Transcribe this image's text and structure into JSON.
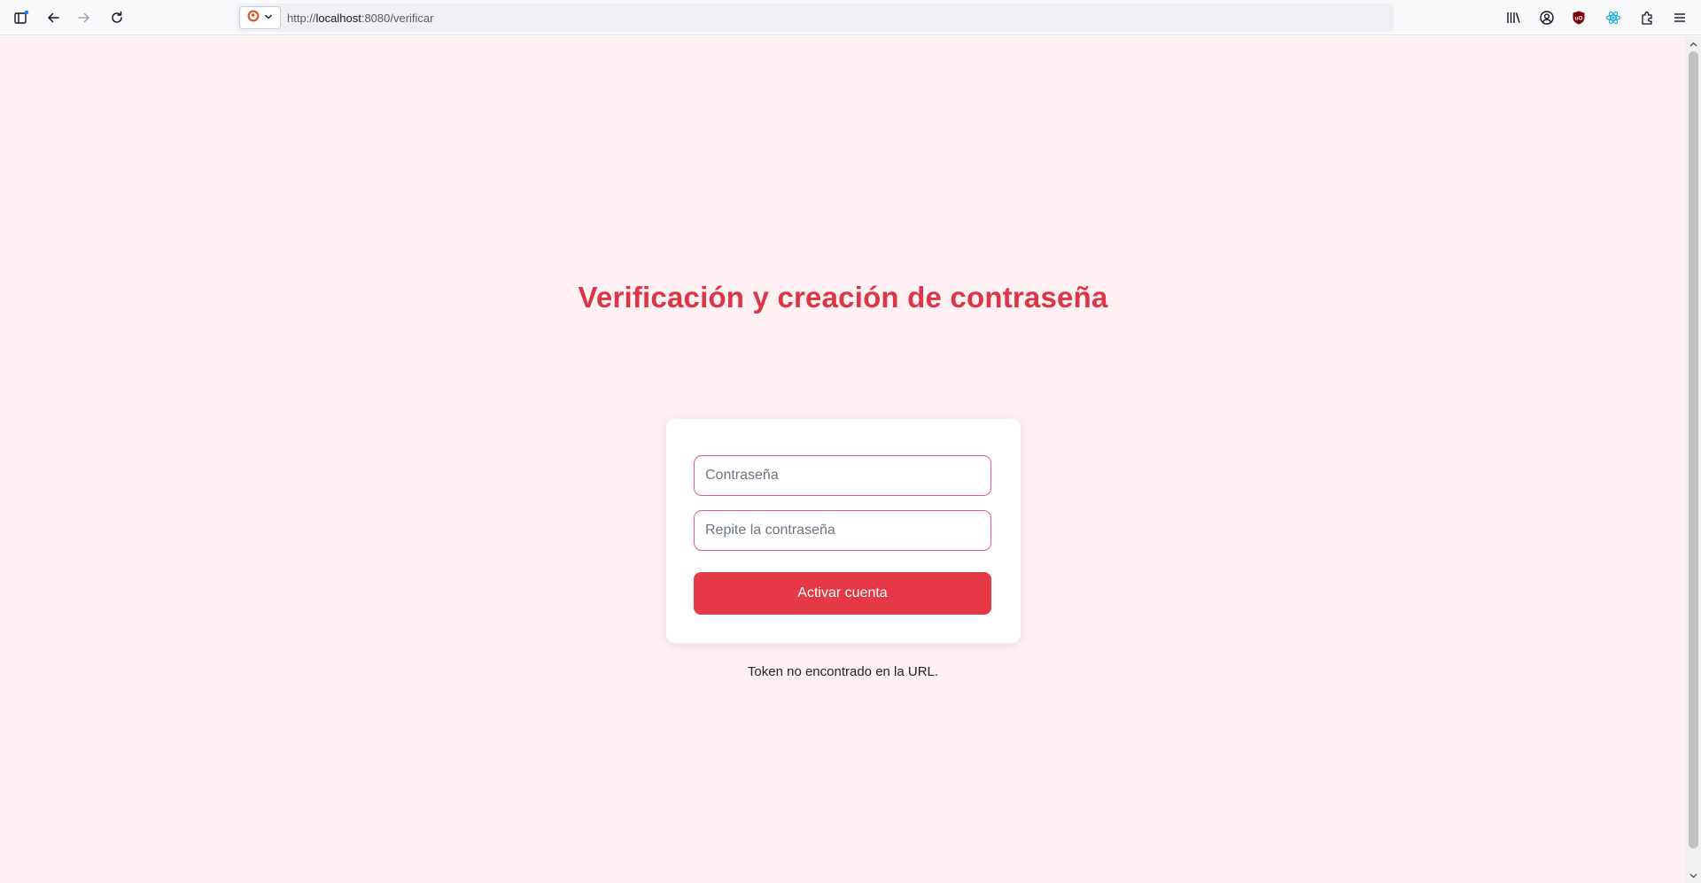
{
  "browser": {
    "url_prefix": "http://",
    "url_host": "localhost",
    "url_rest": ":8080/verificar"
  },
  "page": {
    "title": "Verificación y creación de contraseña",
    "password_placeholder": "Contraseña",
    "password_value": "",
    "repeat_placeholder": "Repite la contraseña",
    "repeat_value": "",
    "submit_label": "Activar cuenta",
    "message": "Token no encontrado en la URL."
  },
  "colors": {
    "accent": "#dc3545",
    "button": "#e63947",
    "background": "#fff0f3",
    "input_border": "#e0607a"
  },
  "icons": {
    "toolbar_left": [
      "sidebar-icon",
      "back-icon",
      "forward-icon",
      "reload-icon"
    ],
    "toolbar_right": [
      "library-icon",
      "account-icon",
      "ublock-icon",
      "react-devtools-icon",
      "extensions-icon",
      "menu-icon"
    ]
  }
}
